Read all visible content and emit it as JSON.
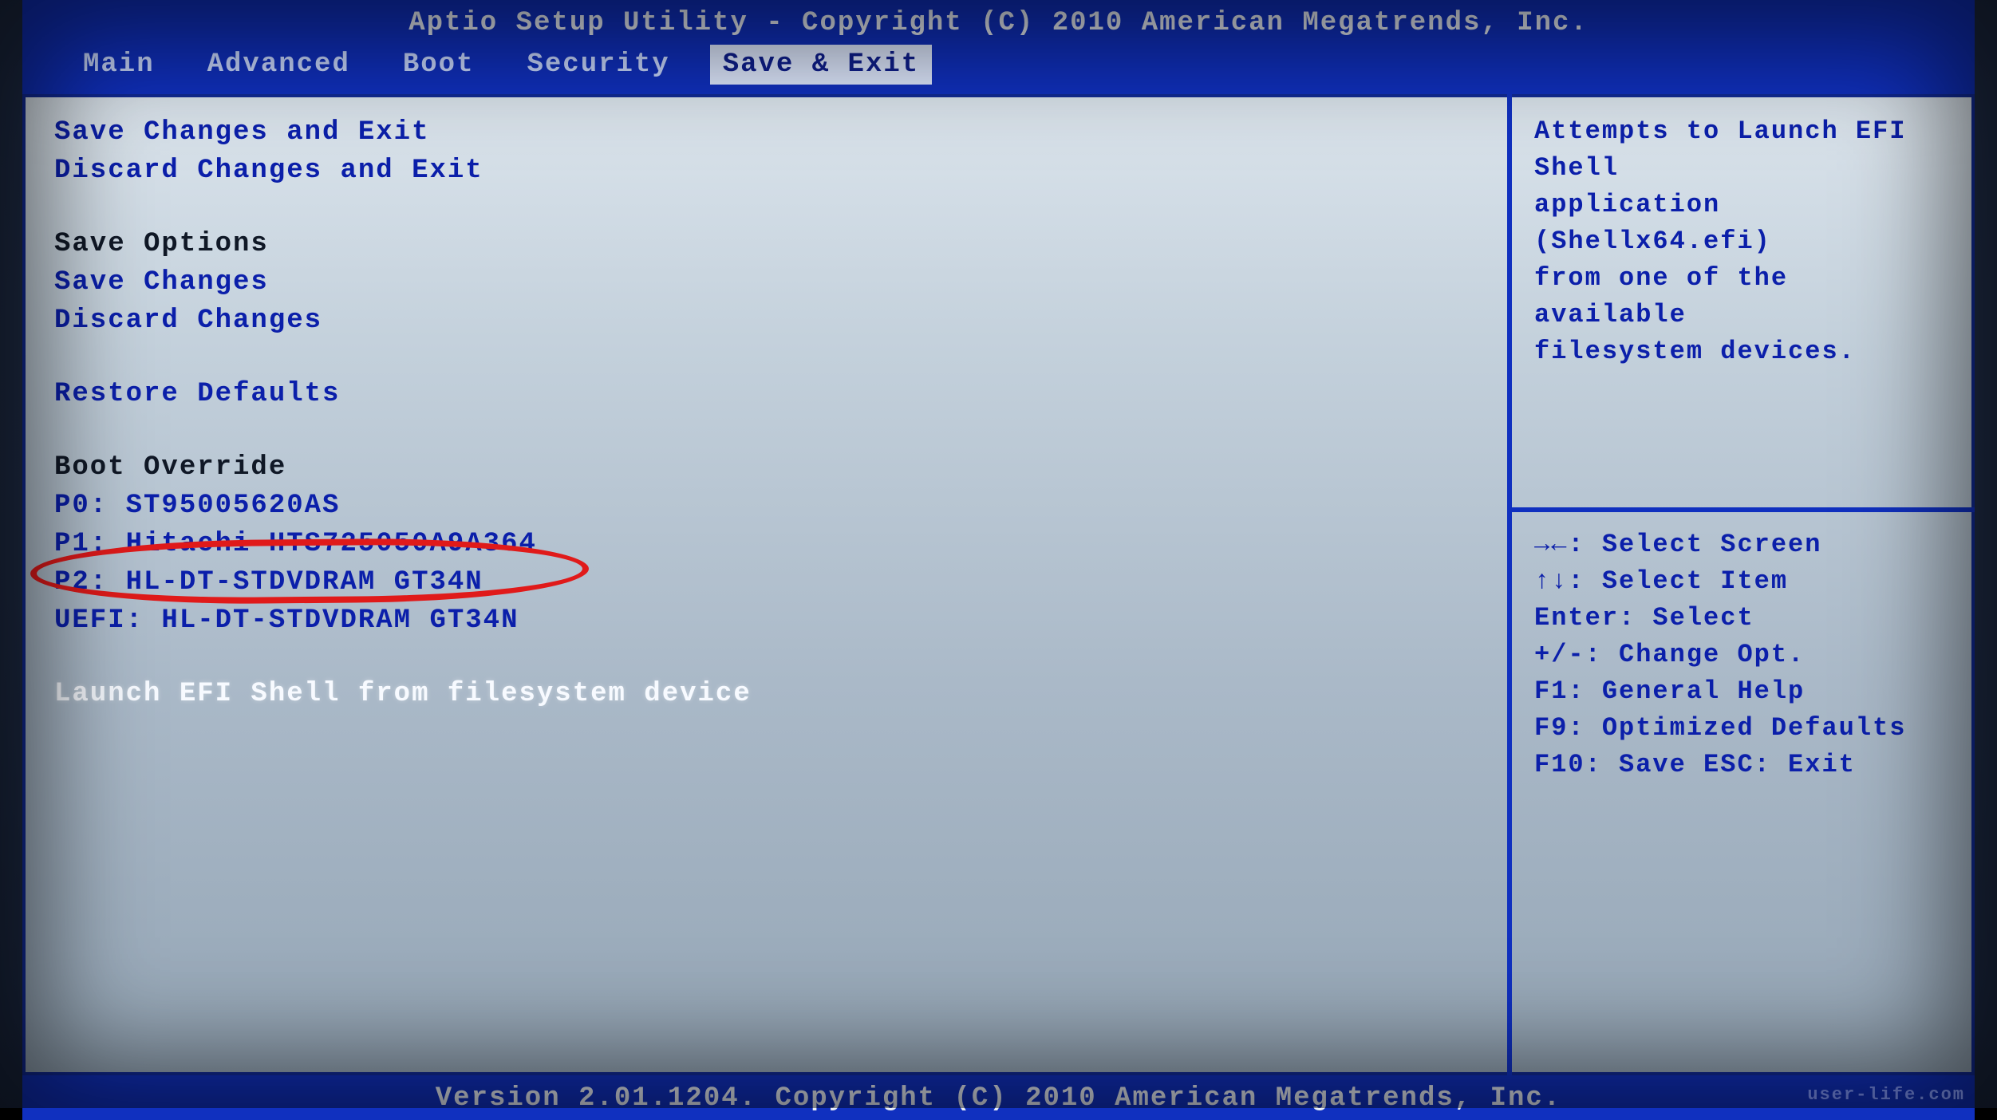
{
  "header": {
    "title": "Aptio Setup Utility - Copyright (C) 2010 American Megatrends, Inc."
  },
  "tabs": [
    {
      "label": "Main"
    },
    {
      "label": "Advanced"
    },
    {
      "label": "Boot"
    },
    {
      "label": "Security"
    },
    {
      "label": "Save & Exit",
      "active": true
    }
  ],
  "menu": {
    "save_exit": "Save Changes and Exit",
    "discard_exit": "Discard Changes and Exit",
    "save_options_heading": "Save Options",
    "save_changes": "Save Changes",
    "discard_changes": "Discard Changes",
    "restore_defaults": "Restore Defaults",
    "boot_override_heading": "Boot Override",
    "boot_p0": "P0: ST95005620AS",
    "boot_p1": "P1: Hitachi HTS725050A9A364",
    "boot_p2": "P2: HL-DT-STDVDRAM GT34N",
    "boot_uefi": "UEFI: HL-DT-STDVDRAM GT34N",
    "launch_efi": "Launch EFI Shell from filesystem device"
  },
  "help": {
    "line1": "Attempts to Launch EFI Shell",
    "line2": "application (Shellx64.efi)",
    "line3": "from one of the available",
    "line4": "filesystem devices."
  },
  "keys": {
    "select_screen": "Select Screen",
    "select_item": "Select Item",
    "enter": "Enter: Select",
    "change": "+/-: Change Opt.",
    "f1": "F1: General Help",
    "f9": "F9: Optimized Defaults",
    "f10": "F10: Save  ESC: Exit",
    "lr_glyph": "→←:",
    "ud_glyph": "↑↓:"
  },
  "footer": {
    "text": "Version 2.01.1204. Copyright (C) 2010 American Megatrends, Inc."
  },
  "watermark": "user-life.com"
}
